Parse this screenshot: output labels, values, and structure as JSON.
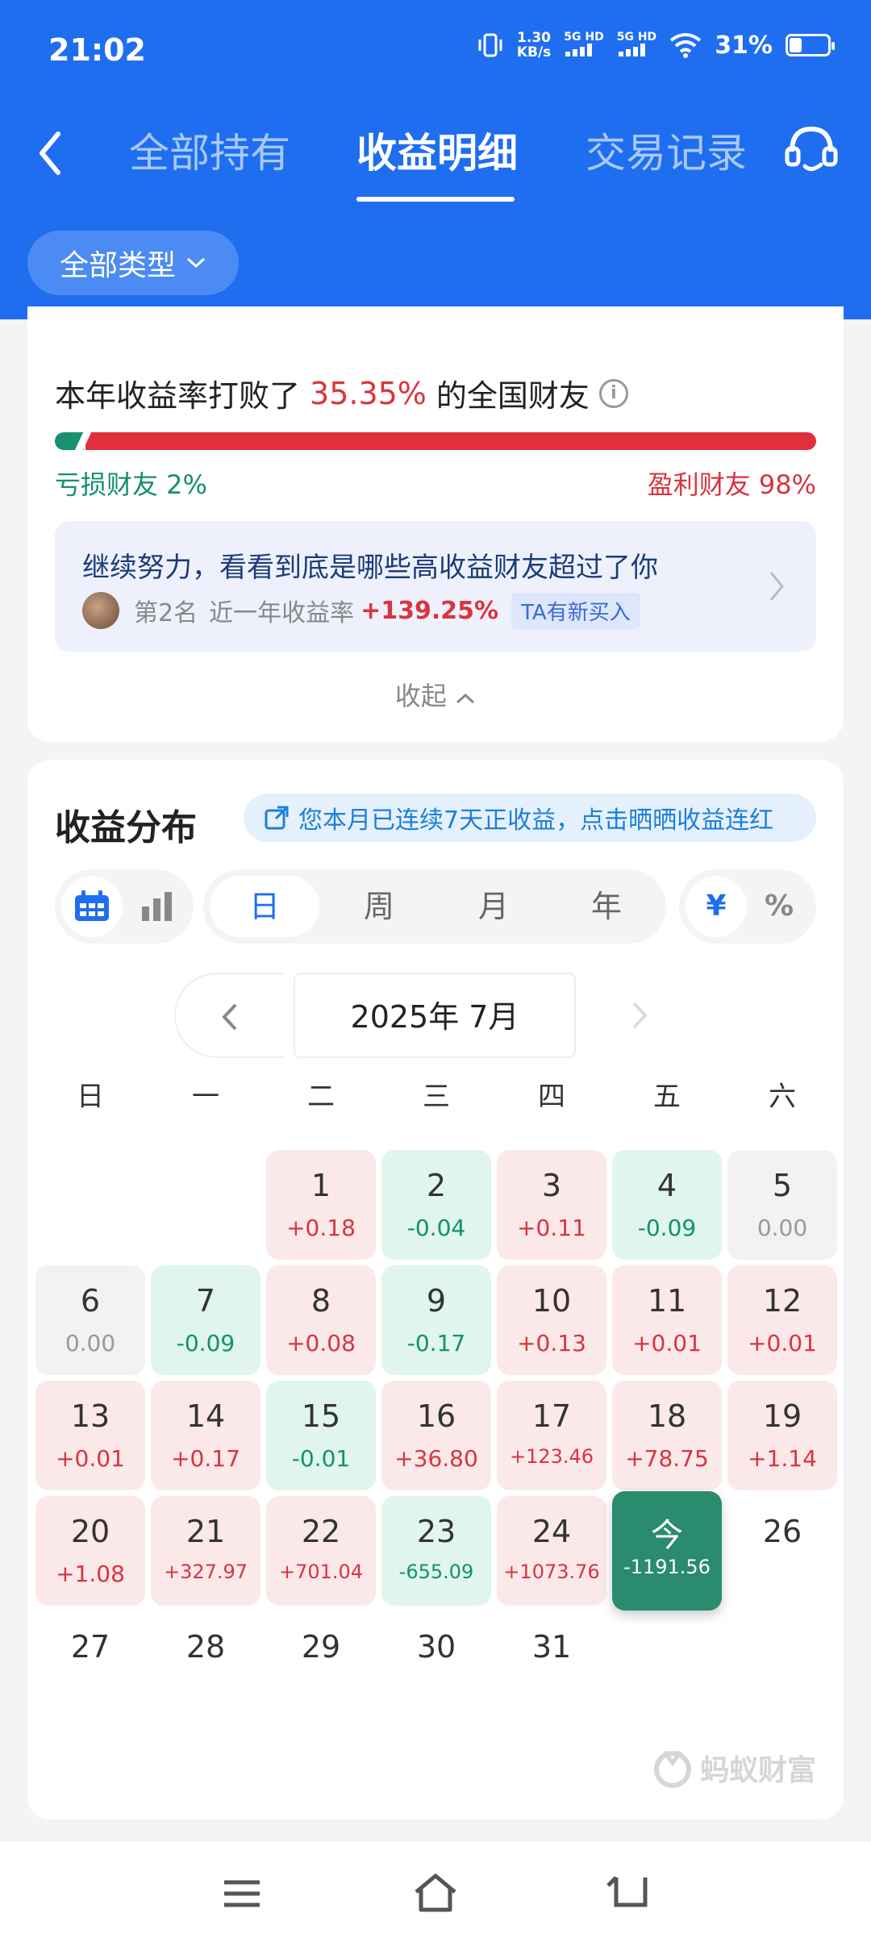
{
  "status_bar": {
    "time": "21:02",
    "speed_value": "1.30",
    "speed_unit": "KB/s",
    "net1": "5G HD",
    "net2": "5G HD",
    "battery": "31%"
  },
  "tabs": [
    {
      "label": "全部持有",
      "active": false
    },
    {
      "label": "收益明细",
      "active": true
    },
    {
      "label": "交易记录",
      "active": false
    }
  ],
  "filter": {
    "label": "全部类型"
  },
  "ranking": {
    "prefix": "本年收益率打败了",
    "percent": "35.35%",
    "suffix": "的全国财友",
    "lose_label": "亏损财友 2%",
    "win_label": "盈利财友 98%",
    "lose_fraction": 0.02
  },
  "friend_promo": {
    "title": "继续努力，看看到底是哪些高收益财友超过了你",
    "rank": "第2名",
    "rate_label": "近一年收益率",
    "rate_value": "+139.25%",
    "tag": "TA有新买入"
  },
  "collapse_label": "收起",
  "distribution": {
    "title": "收益分布",
    "streak_text": "您本月已连续7天正收益，点击晒晒收益连红",
    "periods": [
      "日",
      "周",
      "月",
      "年"
    ],
    "active_period": "日",
    "units": [
      "¥",
      "%"
    ],
    "active_unit": "¥",
    "month_label": "2025年 7月",
    "weekdays": [
      "日",
      "一",
      "二",
      "三",
      "四",
      "五",
      "六"
    ]
  },
  "calendar_days": [
    {
      "day": "1",
      "value": "+0.18",
      "kind": "pos"
    },
    {
      "day": "2",
      "value": "-0.04",
      "kind": "neg"
    },
    {
      "day": "3",
      "value": "+0.11",
      "kind": "pos"
    },
    {
      "day": "4",
      "value": "-0.09",
      "kind": "neg"
    },
    {
      "day": "5",
      "value": "0.00",
      "kind": "zero"
    },
    {
      "day": "6",
      "value": "0.00",
      "kind": "zero"
    },
    {
      "day": "7",
      "value": "-0.09",
      "kind": "neg"
    },
    {
      "day": "8",
      "value": "+0.08",
      "kind": "pos"
    },
    {
      "day": "9",
      "value": "-0.17",
      "kind": "neg"
    },
    {
      "day": "10",
      "value": "+0.13",
      "kind": "pos"
    },
    {
      "day": "11",
      "value": "+0.01",
      "kind": "pos"
    },
    {
      "day": "12",
      "value": "+0.01",
      "kind": "pos"
    },
    {
      "day": "13",
      "value": "+0.01",
      "kind": "pos"
    },
    {
      "day": "14",
      "value": "+0.17",
      "kind": "pos"
    },
    {
      "day": "15",
      "value": "-0.01",
      "kind": "neg"
    },
    {
      "day": "16",
      "value": "+36.80",
      "kind": "pos"
    },
    {
      "day": "17",
      "value": "+123.46",
      "kind": "pos"
    },
    {
      "day": "18",
      "value": "+78.75",
      "kind": "pos"
    },
    {
      "day": "19",
      "value": "+1.14",
      "kind": "pos"
    },
    {
      "day": "20",
      "value": "+1.08",
      "kind": "pos"
    },
    {
      "day": "21",
      "value": "+327.97",
      "kind": "pos"
    },
    {
      "day": "22",
      "value": "+701.04",
      "kind": "pos"
    },
    {
      "day": "23",
      "value": "-655.09",
      "kind": "neg"
    },
    {
      "day": "24",
      "value": "+1073.76",
      "kind": "pos"
    },
    {
      "day": "今",
      "value": "-1191.56",
      "kind": "today"
    },
    {
      "day": "26",
      "value": "",
      "kind": "plain"
    },
    {
      "day": "27",
      "value": "",
      "kind": "plain"
    },
    {
      "day": "28",
      "value": "",
      "kind": "plain"
    },
    {
      "day": "29",
      "value": "",
      "kind": "plain"
    },
    {
      "day": "30",
      "value": "",
      "kind": "plain"
    },
    {
      "day": "31",
      "value": "",
      "kind": "plain"
    }
  ],
  "watermark": "蚂蚁财富",
  "colors": {
    "brand_blue": "#1f6ef0",
    "gain_red": "#d9343f",
    "loss_green": "#14906e",
    "today_green": "#2a8b6e"
  }
}
